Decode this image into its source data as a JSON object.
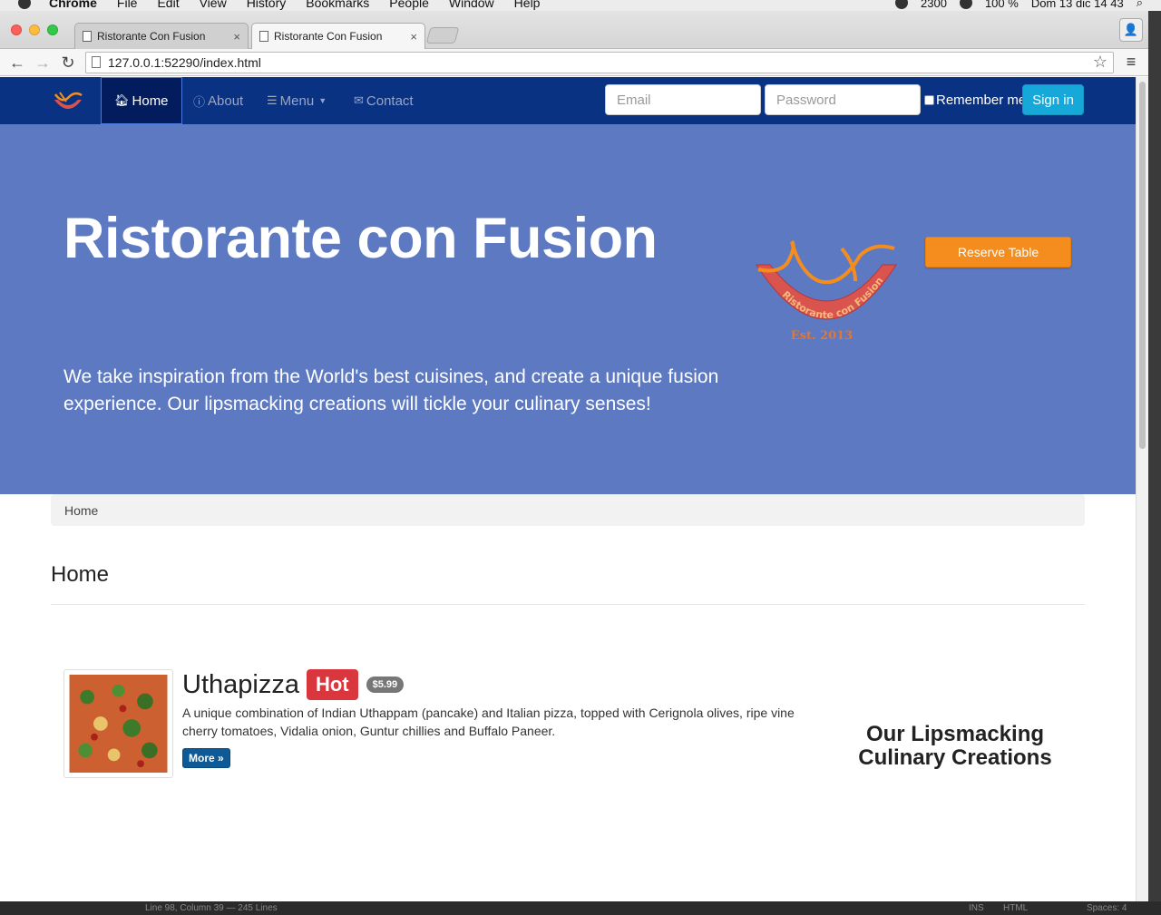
{
  "os_menubar": {
    "app": "Chrome",
    "items": [
      "File",
      "Edit",
      "View",
      "History",
      "Bookmarks",
      "People",
      "Window",
      "Help"
    ],
    "status": {
      "badge_count": "2300",
      "battery": "100 %",
      "datetime": "Dom 13 dic  14 43"
    }
  },
  "browser": {
    "tabs": [
      {
        "title": "Ristorante Con Fusion",
        "close": "×"
      },
      {
        "title": "Ristorante Con Fusion",
        "close": "×"
      }
    ],
    "url": "127.0.0.1:52290/index.html",
    "buttons": {
      "back": "←",
      "forward": "→",
      "reload": "↻",
      "star": "☆",
      "menu": "≡"
    }
  },
  "navbar": {
    "links": [
      {
        "icon": "home-icon",
        "label": "Home"
      },
      {
        "icon": "info-icon",
        "label": "About"
      },
      {
        "icon": "list-icon",
        "label": "Menu"
      },
      {
        "icon": "envelope-icon",
        "label": "Contact"
      }
    ],
    "email_placeholder": "Email",
    "password_placeholder": "Password",
    "remember_label": "Remember me",
    "signin_label": "Sign in"
  },
  "jumbotron": {
    "title": "Ristorante con Fusion",
    "lead": "We take inspiration from the World's best cuisines, and create a unique fusion experience. Our lipsmacking creations will tickle your culinary senses!",
    "logo_text": "Ristorante con Fusion",
    "logo_est": "Est. 2013",
    "reserve_label": "Reserve Table"
  },
  "breadcrumb": {
    "current": "Home"
  },
  "page_header": {
    "title": "Home"
  },
  "featured_dish": {
    "name": "Uthapizza",
    "label": "Hot",
    "price": "$5.99",
    "description": "A unique combination of Indian Uthappam (pancake) and Italian pizza, topped with Cerignola olives, ripe vine cherry tomatoes, Vidalia onion, Guntur chillies and Buffalo Paneer.",
    "more_label": "More »"
  },
  "side_heading": "Our Lipsmacking Culinary Creations",
  "editor_status": {
    "position": "Line 98, Column 39 — 245 Lines",
    "mode_ins": "INS",
    "language": "HTML",
    "spaces": "Spaces: 4"
  },
  "colors": {
    "navbar": "#0a3283",
    "jumbotron": "#5d79c1",
    "reserve": "#f58d1e",
    "signin": "#16a8d8",
    "hot_label": "#d9363e"
  }
}
